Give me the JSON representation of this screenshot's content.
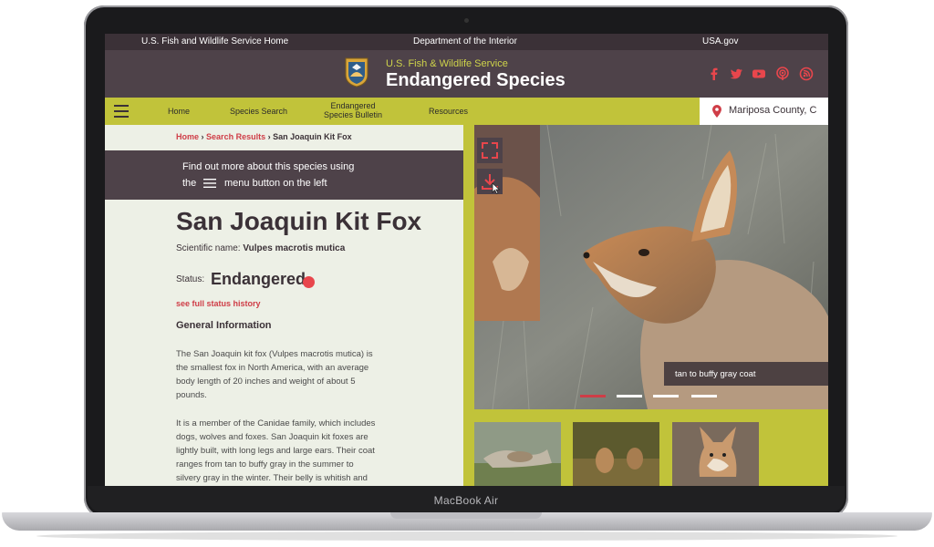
{
  "device": {
    "label": "MacBook Air"
  },
  "utility_bar": {
    "left": "U.S. Fish and Wildlife Service Home",
    "center": "Department of the Interior",
    "right": "USA.gov"
  },
  "header": {
    "service": "U.S. Fish & Wildlife Service",
    "title": "Endangered Species",
    "social_icons": [
      "facebook-icon",
      "twitter-icon",
      "youtube-icon",
      "podcast-icon",
      "rss-icon"
    ],
    "accent": "#e8464c"
  },
  "nav": {
    "items": [
      {
        "label": "Home"
      },
      {
        "label": "Species Search"
      },
      {
        "label_line1": "Endangered",
        "label_line2": "Species Bulletin"
      },
      {
        "label": "Resources"
      }
    ],
    "location": "Mariposa County, C",
    "bar_color": "#c1c33a"
  },
  "breadcrumb": {
    "home": "Home",
    "search": "Search Results",
    "current": "San Joaquin Kit Fox",
    "separator": "›"
  },
  "notice": {
    "line1": "Find out more about this species using",
    "line2_pre": "the",
    "line2_post": "menu button on the left"
  },
  "species": {
    "name": "San Joaquin Kit Fox",
    "scientific_label": "Scientific name:",
    "scientific_name": "Vulpes macrotis mutica",
    "status_label": "Status:",
    "status": "Endangered",
    "status_color": "#e8464c",
    "history_link": "see full status history"
  },
  "general_info": {
    "heading": "General Information",
    "p1": [
      "The San Joaquin kit fox (Vulpes macrotis mutica) is",
      "the smallest fox in North America, with an average",
      "body length of 20 inches and weight of about 5",
      "pounds."
    ],
    "p2": [
      "It is a member of the Canidae family, which includes",
      "dogs, wolves and foxes. San Joaquin kit foxes are",
      "lightly built, with long legs and large ears. Their coat",
      "ranges from tan to buffy gray in the summer to",
      "silvery gray in the winter. Their belly is whitish and"
    ]
  },
  "gallery": {
    "caption": "tan to buffy gray coat",
    "slide_count": 4,
    "active_slide": 1,
    "thumbnails": 3
  }
}
